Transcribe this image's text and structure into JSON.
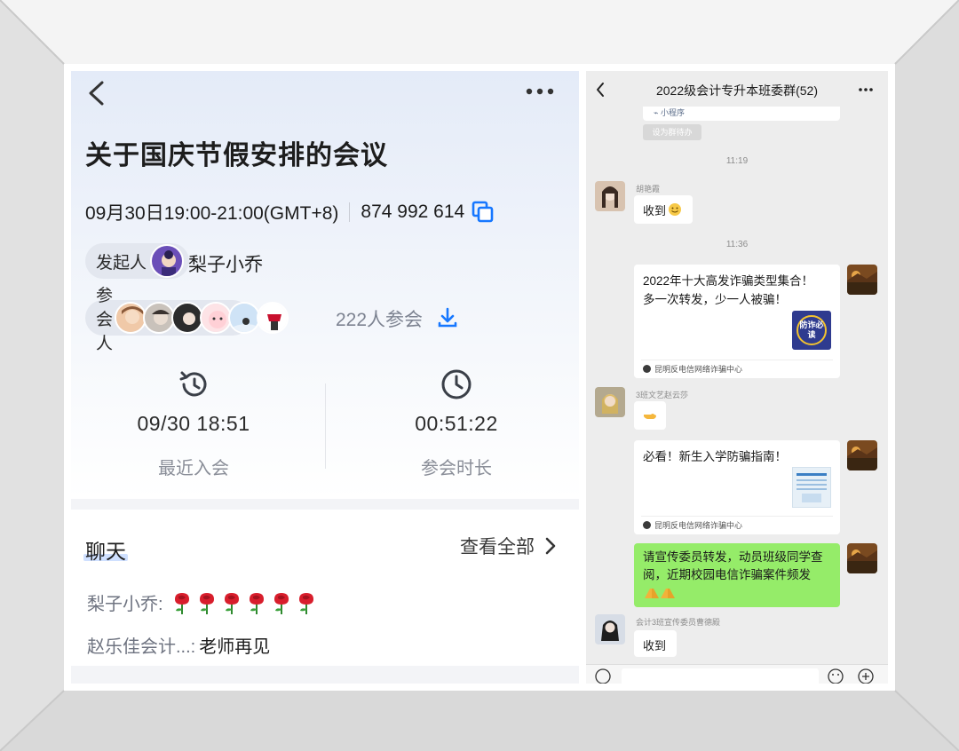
{
  "meeting": {
    "title": "关于国庆节假安排的会议",
    "time": "09月30日19:00-21:00(GMT+8)",
    "meeting_id": "874 992 614",
    "host_label": "发起人",
    "host_name": "梨子小乔",
    "attendee_label": "参会人",
    "attendee_count": "222人参会",
    "stats": [
      {
        "value": "09/30 18:51",
        "label": "最近入会"
      },
      {
        "value": "00:51:22",
        "label": "参会时长"
      }
    ]
  },
  "chat_preview": {
    "heading": "聊天",
    "view_all": "查看全部",
    "messages": [
      {
        "sender": "梨子小乔:",
        "text": "",
        "emoji": "rose-x6"
      },
      {
        "sender": "赵乐佳会计...:",
        "text": "老师再见"
      }
    ]
  },
  "group_chat": {
    "title": "2022级会计专升本班委群(52)",
    "mini_program_label": "小程序",
    "set_button": "设为群待办",
    "time_1": "11:19",
    "msg1_sender": "胡艳霞",
    "msg1_text": "收到",
    "time_2": "11:36",
    "card1_title_1": "2022年十大高发诈骗类型集合！",
    "card1_title_2": "多一次转发，少一人被骗！",
    "card1_thumb_text": "防诈必读",
    "card1_source": "昆明反电信网络诈骗中心",
    "msg2_sender": "3班文艺赵云莎",
    "card2_title": "必看！新生入学防骗指南！",
    "card2_source": "昆明反电信网络诈骗中心",
    "green_text": "请宣传委员转发，动员班级同学查阅，近期校园电信诈骗案件频发",
    "msg3_sender": "会计3班宣传委员曹德殿",
    "msg3_text": "收到"
  },
  "colors": {
    "accent_blue": "#1677ff",
    "wechat_green": "#95ec69",
    "rose_red": "#d81e2c"
  }
}
